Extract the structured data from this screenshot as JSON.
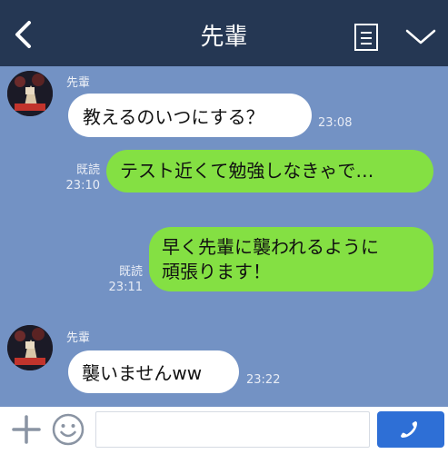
{
  "header": {
    "title": "先輩",
    "back_icon": "chevron-left-icon",
    "note_icon": "note-icon",
    "menu_icon": "chevron-down-icon",
    "bg_color": "#253753"
  },
  "chat": {
    "bg_color": "#7392c4",
    "messages": [
      {
        "sender": "先輩",
        "text": "教えるのいつにする？",
        "time": "23:08",
        "side": "left"
      },
      {
        "text": "テスト近くて勉強しなきゃで…",
        "read": "既読",
        "time": "23:10",
        "side": "right"
      },
      {
        "line1": "早く先輩に襲われるように",
        "line2": "頑張ります！",
        "read": "既読",
        "time": "23:11",
        "side": "right"
      },
      {
        "sender": "先輩",
        "text": "襲いませんww",
        "time": "23:22",
        "side": "left"
      }
    ]
  },
  "footer": {
    "plus_icon": "plus-icon",
    "emoji_icon": "smiley-icon",
    "input_placeholder": "",
    "call_icon": "phone-icon",
    "accent_color": "#2e6fd6"
  }
}
